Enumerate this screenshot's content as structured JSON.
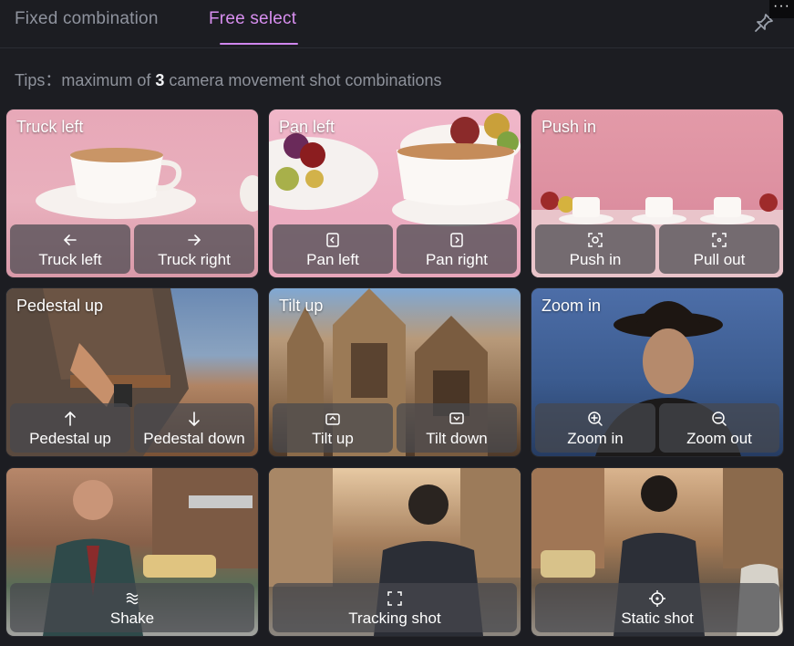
{
  "tabs": [
    {
      "label": "Fixed combination",
      "active": false
    },
    {
      "label": "Free select",
      "active": true
    }
  ],
  "more_label": "···",
  "tips": {
    "prefix": "Tips：maximum of ",
    "count": "3",
    "suffix": " camera movement shot combinations"
  },
  "cards": [
    {
      "title": "Truck left",
      "buttons": [
        {
          "label": "Truck left",
          "icon": "arrow-left-icon"
        },
        {
          "label": "Truck right",
          "icon": "arrow-right-icon"
        }
      ]
    },
    {
      "title": "Pan left",
      "buttons": [
        {
          "label": "Pan left",
          "icon": "pan-left-icon"
        },
        {
          "label": "Pan right",
          "icon": "pan-right-icon"
        }
      ]
    },
    {
      "title": "Push in",
      "buttons": [
        {
          "label": "Push in",
          "icon": "push-in-icon"
        },
        {
          "label": "Pull out",
          "icon": "pull-out-icon"
        }
      ]
    },
    {
      "title": "Pedestal up",
      "buttons": [
        {
          "label": "Pedestal up",
          "icon": "arrow-up-icon"
        },
        {
          "label": "Pedestal down",
          "icon": "arrow-down-icon"
        }
      ]
    },
    {
      "title": "Tilt up",
      "buttons": [
        {
          "label": "Tilt up",
          "icon": "tilt-up-icon"
        },
        {
          "label": "Tilt down",
          "icon": "tilt-down-icon"
        }
      ]
    },
    {
      "title": "Zoom in",
      "buttons": [
        {
          "label": "Zoom in",
          "icon": "zoom-in-icon"
        },
        {
          "label": "Zoom out",
          "icon": "zoom-out-icon"
        }
      ]
    },
    {
      "title": "",
      "buttons": [
        {
          "label": "Shake",
          "icon": "shake-icon"
        }
      ]
    },
    {
      "title": "",
      "buttons": [
        {
          "label": "Tracking shot",
          "icon": "tracking-icon"
        }
      ]
    },
    {
      "title": "",
      "buttons": [
        {
          "label": "Static shot",
          "icon": "target-icon"
        }
      ]
    }
  ],
  "colors": {
    "accent": "#cf86ee",
    "background": "#1c1d22",
    "button": "#46484e"
  }
}
